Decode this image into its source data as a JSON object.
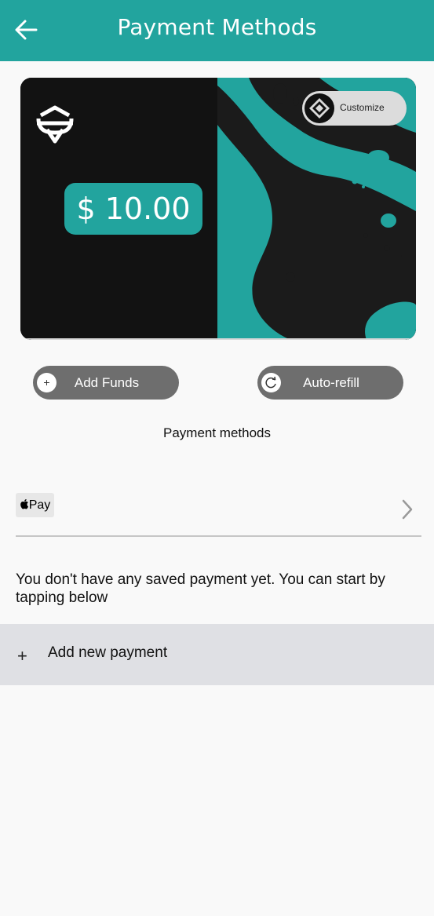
{
  "header": {
    "title": "Payment Methods",
    "back_icon": "arrow-left-icon",
    "background": "#22a49e"
  },
  "card": {
    "balance": "$ 10.00",
    "accent": "#22a49e",
    "customize_label": "Customize",
    "logo_icon": "brand-logo-icon"
  },
  "actions": {
    "add_funds_label": "Add Funds",
    "add_funds_icon": "plus-circle-icon",
    "auto_refill_label": "Auto-refill",
    "auto_refill_icon": "refresh-icon"
  },
  "payment_methods": {
    "section_title": "Payment methods",
    "apple_pay_label": "Pay",
    "apple_pay_icon": "apple-icon",
    "empty_message": "You don't have any saved payment yet. You can start by tapping below",
    "add_new_label": "Add new payment",
    "add_new_symbol": "+"
  }
}
